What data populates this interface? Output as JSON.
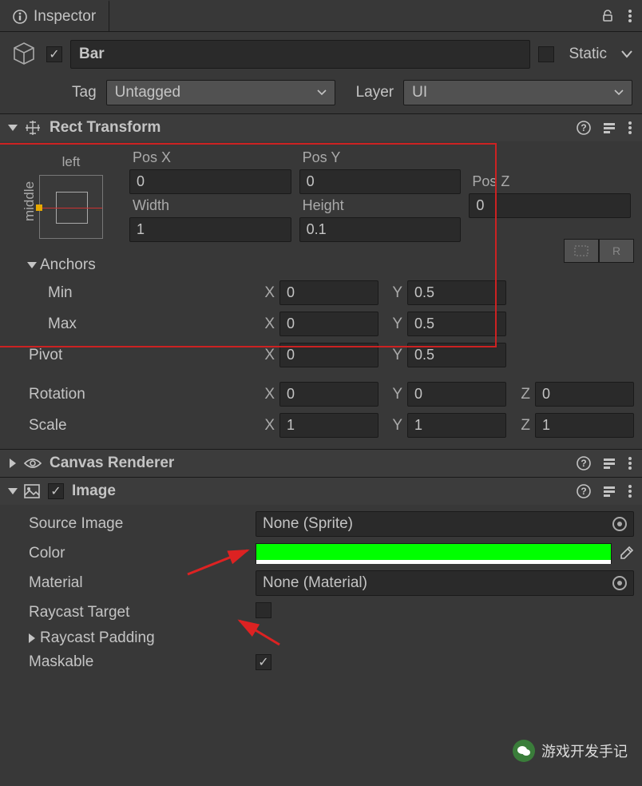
{
  "tab": {
    "title": "Inspector"
  },
  "header": {
    "enabled_check": "✓",
    "name": "Bar",
    "static_label": "Static",
    "tag_label": "Tag",
    "tag_value": "Untagged",
    "layer_label": "Layer",
    "layer_value": "UI"
  },
  "rectTransform": {
    "title": "Rect Transform",
    "anchor_top": "left",
    "anchor_side": "middle",
    "posx_label": "Pos X",
    "posx": "0",
    "posy_label": "Pos Y",
    "posy": "0",
    "posz_label": "Pos Z",
    "posz": "0",
    "width_label": "Width",
    "width": "1",
    "height_label": "Height",
    "height": "0.1",
    "blueprint_label": "R",
    "anchors_label": "Anchors",
    "min_label": "Min",
    "min_x": "0",
    "min_y": "0.5",
    "max_label": "Max",
    "max_x": "0",
    "max_y": "0.5",
    "pivot_label": "Pivot",
    "pivot_x": "0",
    "pivot_y": "0.5",
    "rotation_label": "Rotation",
    "rot_x": "0",
    "rot_y": "0",
    "rot_z": "0",
    "scale_label": "Scale",
    "scale_x": "1",
    "scale_y": "1",
    "scale_z": "1",
    "x_l": "X",
    "y_l": "Y",
    "z_l": "Z"
  },
  "canvasRenderer": {
    "title": "Canvas Renderer"
  },
  "image": {
    "title": "Image",
    "source_label": "Source Image",
    "source_value": "None (Sprite)",
    "color_label": "Color",
    "color_value": "#00ff00",
    "material_label": "Material",
    "material_value": "None (Material)",
    "raycast_label": "Raycast Target",
    "raycast_padding_label": "Raycast Padding",
    "maskable_label": "Maskable",
    "maskable_check": "✓"
  },
  "watermark": "游戏开发手记"
}
